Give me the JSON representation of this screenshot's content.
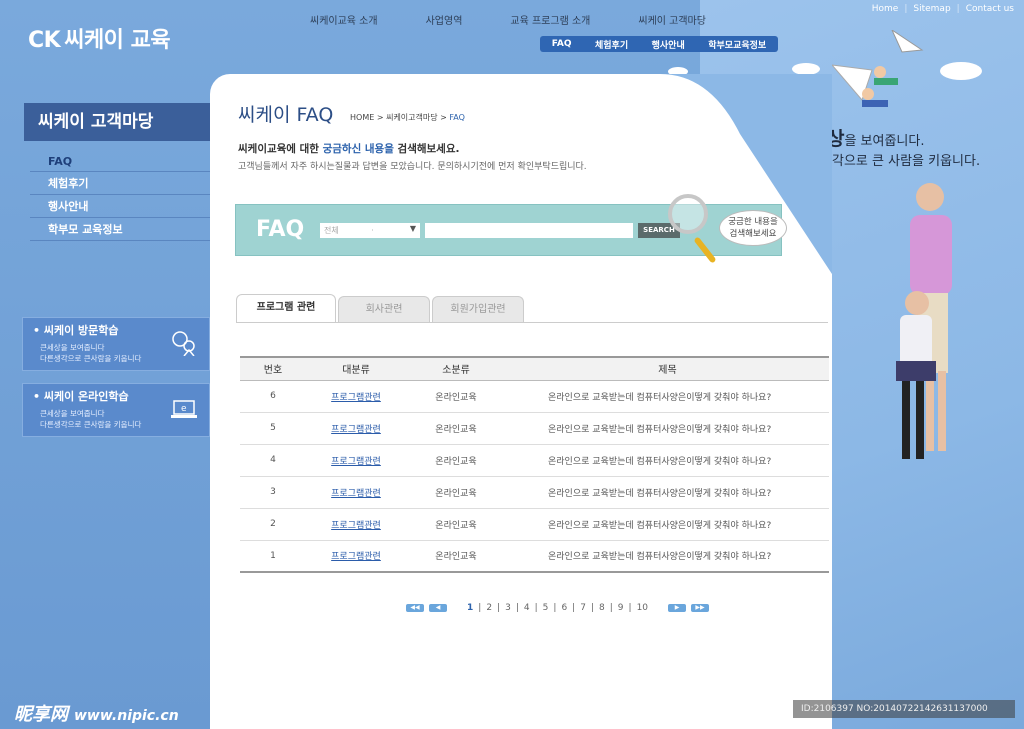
{
  "brand": {
    "logo_ck": "CK",
    "logo_text": "씨케이 교육"
  },
  "utility": {
    "home": "Home",
    "sitemap": "Sitemap",
    "contact": "Contact us"
  },
  "gnb": [
    "씨케이교육 소개",
    "사업영역",
    "교육 프로그램 소개",
    "씨케이 고객마당"
  ],
  "subnav": [
    "FAQ",
    "체험후기",
    "행사안내",
    "학부모교육정보"
  ],
  "sidebar": {
    "title": "씨케이 고객마당",
    "items": [
      {
        "label": "FAQ",
        "active": true
      },
      {
        "label": "체험후기"
      },
      {
        "label": "행사안내"
      },
      {
        "label": "학부모 교육정보"
      }
    ],
    "banners": [
      {
        "title": "• 씨케이 방문학습",
        "desc1": "큰세상을 보여줍니다",
        "desc2": "다른생각으로 큰사람을 키웁니다",
        "icon": "visit-person-icon"
      },
      {
        "title": "• 씨케이 온라인학습",
        "desc1": "큰세상을 보여줍니다",
        "desc2": "다른생각으로 큰사람을 키웁니다",
        "icon": "laptop-icon"
      }
    ]
  },
  "page": {
    "title": "씨케이 FAQ",
    "breadcrumb": {
      "home": "HOME",
      "sep1": " > ",
      "section": "씨케이고객마당",
      "sep2": " > ",
      "current": "FAQ"
    },
    "intro_a": "씨케이교육에 대한 ",
    "intro_hl": "궁금하신 내용을",
    "intro_b": " 검색해보세요.",
    "intro_sub": "고객님들께서 자주 하시는질물과 답변을 모았습니다. 문의하시기전에 먼저 확인부탁드립니다."
  },
  "search": {
    "label": "FAQ",
    "select_value": "전체",
    "select_dot": "·",
    "button": "SEARCH",
    "bubble1": "궁금한 내용을",
    "bubble2": "검색해보세요"
  },
  "tabs": [
    "프로그램 관련",
    "회사관련",
    "회원가입관련"
  ],
  "table": {
    "headers": [
      "번호",
      "대분류",
      "소분류",
      "제목"
    ],
    "rows": [
      {
        "no": "6",
        "cat": "프로그램관련",
        "sub": "온라인교육",
        "title": "온라인으로 교육받는데 컴퓨터사양은이떻게 갖춰야 하나요?"
      },
      {
        "no": "5",
        "cat": "프로그램관련",
        "sub": "온라인교육",
        "title": "온라인으로 교육받는데 컴퓨터사양은이떻게 갖춰야 하나요?"
      },
      {
        "no": "4",
        "cat": "프로그램관련",
        "sub": "온라인교육",
        "title": "온라인으로 교육받는데 컴퓨터사양은이떻게 갖춰야 하나요?"
      },
      {
        "no": "3",
        "cat": "프로그램관련",
        "sub": "온라인교육",
        "title": "온라인으로 교육받는데 컴퓨터사양은이떻게 갖춰야 하나요?"
      },
      {
        "no": "2",
        "cat": "프로그램관련",
        "sub": "온라인교육",
        "title": "온라인으로 교육받는데 컴퓨터사양은이떻게 갖춰야 하나요?"
      },
      {
        "no": "1",
        "cat": "프로그램관련",
        "sub": "온라인교육",
        "title": "온라인으로 교육받는데 컴퓨터사양은이떻게 갖춰야 하나요?"
      }
    ]
  },
  "pager": {
    "pages": [
      "1",
      "2",
      "3",
      "4",
      "5",
      "6",
      "7",
      "8",
      "9",
      "10"
    ],
    "current": "1"
  },
  "slogan": {
    "line1_a": "큰세상",
    "line1_b": "을 보여줍니다.",
    "line2": "다른 생각으로 큰 사람을 키웁니다."
  },
  "watermark": {
    "site": "昵享网",
    "url": "www.nipic.cn",
    "id": "ID:2106397 NO:20140722142631137000"
  },
  "colors": {
    "background": "#6f9fd6",
    "accent": "#2c62ac",
    "search_bg": "#9fd3d2",
    "sidebar_title": "#3b5f9a"
  }
}
